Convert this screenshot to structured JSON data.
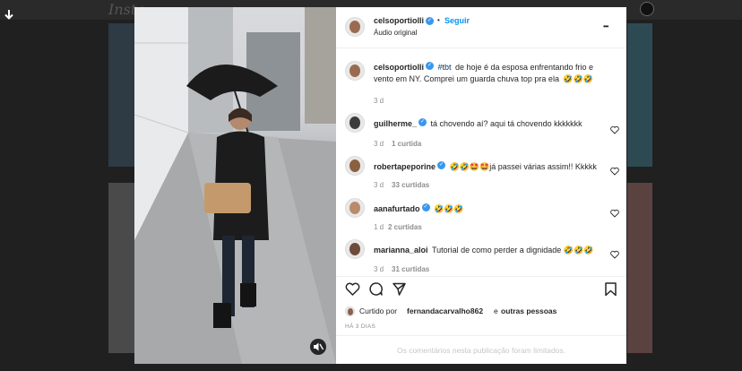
{
  "background": {
    "logo": "Insta"
  },
  "post": {
    "username": "celsoportiolli",
    "follow_label": "Seguir",
    "separator": "•",
    "audio": "Áudio original",
    "caption_tag": "#tbt",
    "caption_text": "de hoje é da esposa enfrentando frio e vento em NY. Comprei um guarda chuva top pra ela",
    "caption_emoji": "🤣🤣🤣",
    "caption_time": "3 d",
    "more_label": "•••"
  },
  "comments": [
    {
      "username": "guilherme_",
      "text": "tá chovendo aí? aqui tá chovendo kkkkkkk",
      "time": "3 d",
      "likes": "1 curtida",
      "verified": true
    },
    {
      "username": "robertapeporine",
      "text": "🤣🤣🤩🤩já passei várias assim!! Kkkkk",
      "time": "3 d",
      "likes": "33 curtidas",
      "verified": true
    },
    {
      "username": "aanafurtado",
      "text": "🤣🤣🤣",
      "time": "1 d",
      "likes": "2 curtidas",
      "verified": true
    },
    {
      "username": "marianna_aloi",
      "text": "Tutorial de como perder a dignidade 🤣🤣🤣",
      "time": "3 d",
      "likes": "31 curtidas",
      "verified": false
    }
  ],
  "likes_line": {
    "prefix": "Curtido por",
    "user": "fernandacarvalho862",
    "connector": "e",
    "others": "outras pessoas"
  },
  "post_date": "HÁ 3 DIAS",
  "comments_limited": "Os comentários nesta publicação foram limitados.",
  "icons": {
    "download": "download-arrow-icon",
    "mute": "speaker-muted-icon",
    "like": "heart-icon",
    "comment": "comment-bubble-icon",
    "share": "paper-plane-icon",
    "save": "bookmark-icon"
  },
  "colors": {
    "link_blue": "#0095f6",
    "verified_blue": "#3897f0",
    "text": "#262626",
    "muted": "#8e8e8e"
  }
}
